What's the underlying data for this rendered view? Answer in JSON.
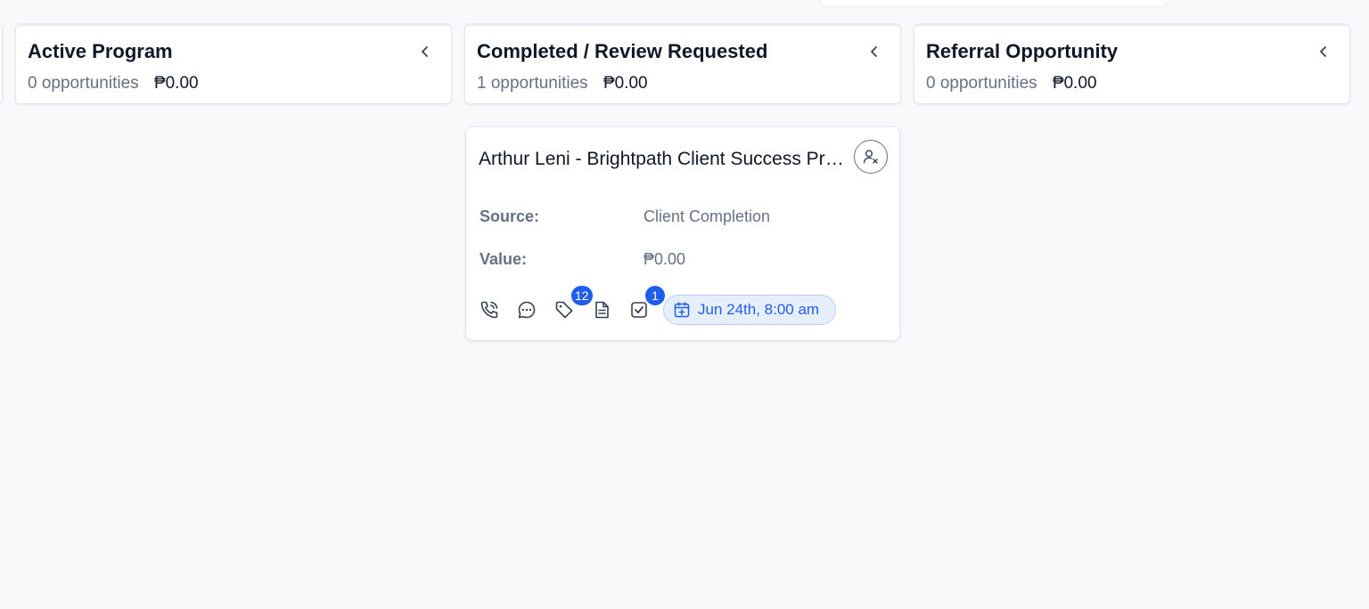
{
  "columns": [
    {
      "title": "Active Program",
      "count": "0 opportunities",
      "amount": "₱0.00"
    },
    {
      "title": "Completed / Review Requested",
      "count": "1 opportunities",
      "amount": "₱0.00"
    },
    {
      "title": "Referral Opportunity",
      "count": "0 opportunities",
      "amount": "₱0.00"
    }
  ],
  "card": {
    "title": "Arthur Leni - Brightpath Client Success Program",
    "fields": [
      {
        "label": "Source:",
        "value": "Client Completion"
      },
      {
        "label": "Value:",
        "value": "₱0.00"
      }
    ],
    "tags_count": "12",
    "tasks_count": "1",
    "appointment": "Jun 24th, 8:00 am"
  },
  "colors": {
    "accent": "#1f5eea",
    "pill_bg": "#e6eefc",
    "muted": "#667085"
  },
  "icons": [
    "chevron-left-icon",
    "user-x-icon",
    "phone-icon",
    "chat-icon",
    "tag-icon",
    "note-icon",
    "task-icon",
    "calendar-plus-icon"
  ]
}
